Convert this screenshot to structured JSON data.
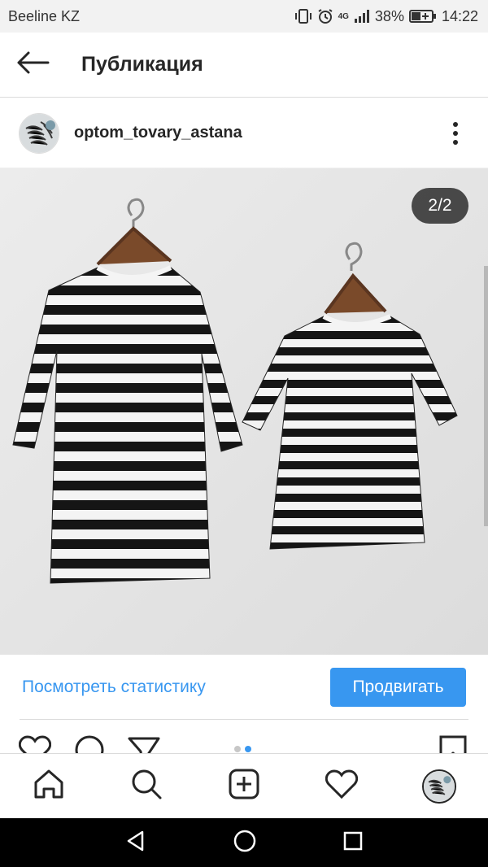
{
  "status_bar": {
    "carrier": "Beeline KZ",
    "network": "4G",
    "battery": "38%",
    "time": "14:22",
    "icons": [
      "vibrate-icon",
      "alarm-icon",
      "signal-icon",
      "battery-icon"
    ]
  },
  "header": {
    "title": "Публикация",
    "back_icon": "arrow-left-icon"
  },
  "post": {
    "username": "optom_tovary_astana",
    "more_icon": "more-vertical-icon",
    "carousel_counter": "2/2",
    "carousel_total": 2,
    "carousel_active_index": 2
  },
  "promo": {
    "stats_link": "Посмотреть статистику",
    "promote_button": "Продвигать"
  },
  "actions": {
    "icons": [
      "heart-icon",
      "comment-icon",
      "share-icon",
      "bookmark-icon"
    ]
  },
  "bottom_nav": {
    "items": [
      "home-icon",
      "search-icon",
      "new-post-icon",
      "activity-icon",
      "profile-icon"
    ]
  },
  "android_nav": {
    "items": [
      "back-triangle-icon",
      "home-circle-icon",
      "recents-square-icon"
    ]
  },
  "colors": {
    "accent": "#3897f0",
    "text": "#262626",
    "border": "#dbdbdb",
    "status_bg": "#f2f2f2",
    "photo_bg": "#e6e6e6"
  }
}
